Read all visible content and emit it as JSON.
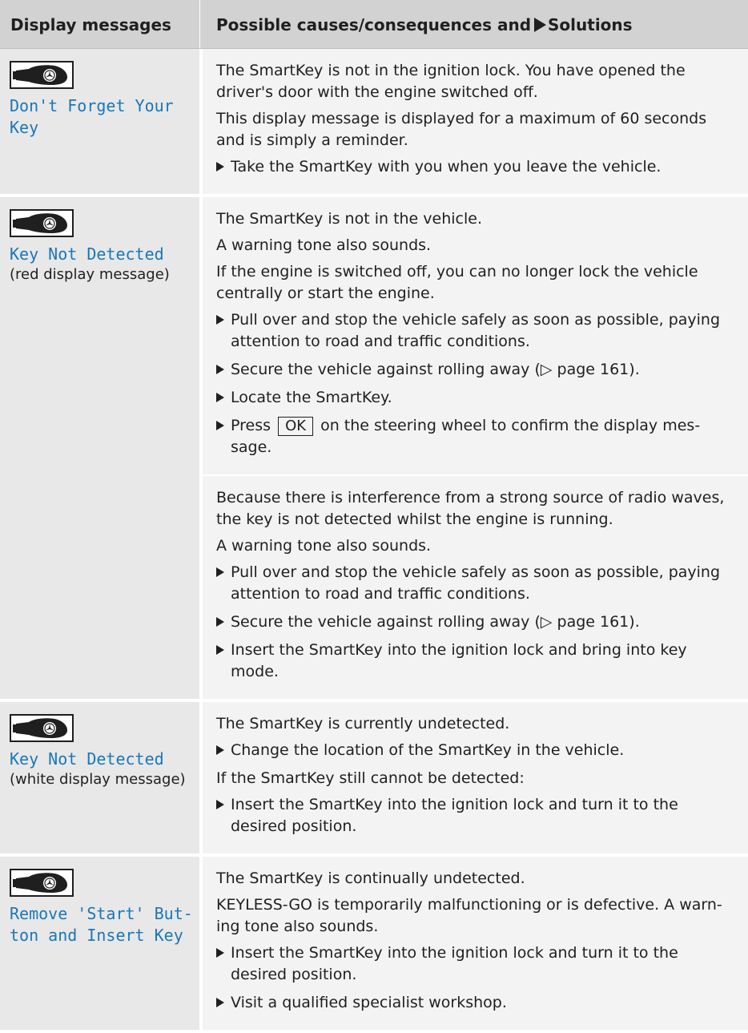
{
  "header": {
    "col1": "Display messages",
    "col2_prefix": "Possible causes/consequences and",
    "col2_suffix": "Solutions"
  },
  "rows": [
    {
      "message": "Don't Forget Your Key",
      "blocks": [
        {
          "paras": [
            "The SmartKey is not in the ignition lock. You have opened the driver's door with the engine switched off.",
            "This display message is displayed for a maximum of 60 seconds and is simply a reminder."
          ],
          "steps": [
            "Take the SmartKey with you when you leave the vehicle."
          ]
        }
      ]
    },
    {
      "message": "Key Not Detected",
      "note": "(red display message)",
      "blocks": [
        {
          "paras": [
            "The SmartKey is not in the vehicle.",
            "A warning tone also sounds.",
            "If the engine is switched off, you can no longer lock the vehicle centrally or start the engine."
          ],
          "steps": [
            "Pull over and stop the vehicle safely as soon as possible, paying attention to road and traffic conditions.",
            "Secure the vehicle against rolling away (▷ page 161).",
            "Locate the SmartKey."
          ],
          "ok_step": {
            "pre": "Press",
            "button": "OK",
            "post": "on the steering wheel to confirm the display mes­sage."
          }
        },
        {
          "paras": [
            "Because there is interference from a strong source of radio waves, the key is not detected whilst the engine is running.",
            "A warning tone also sounds."
          ],
          "steps": [
            "Pull over and stop the vehicle safely as soon as possible, paying attention to road and traffic conditions.",
            "Secure the vehicle against rolling away (▷ page 161).",
            "Insert the SmartKey into the ignition lock and bring into key mode."
          ]
        }
      ]
    },
    {
      "message": "Key Not Detected",
      "note": "(white display mes­sage)",
      "blocks": [
        {
          "paras": [
            "The SmartKey is currently undetected."
          ],
          "steps": [
            "Change the location of the SmartKey in the vehicle."
          ],
          "after_paras": [
            "If the SmartKey still cannot be detected:"
          ],
          "after_steps": [
            "Insert the SmartKey into the ignition lock and turn it to the desired position."
          ]
        }
      ]
    },
    {
      "message": "Remove 'Start' But­ton and Insert Key",
      "blocks": [
        {
          "paras": [
            "The SmartKey is continually undetected.",
            "KEYLESS-GO is temporarily malfunctioning or is defective. A warn­ing tone also sounds."
          ],
          "steps": [
            "Insert the SmartKey into the ignition lock and turn it to the desired position.",
            "Visit a qualified specialist workshop."
          ]
        }
      ]
    }
  ],
  "icons": {
    "key_icon": "smartkey-icon",
    "bullet_icon": "triangle-bullet-icon"
  },
  "colors": {
    "message_text": "#1a77b8",
    "header_bg": "#d2d2d2",
    "left_cell_bg": "#e8e8e8",
    "right_cell_bg": "#f3f3f3"
  }
}
